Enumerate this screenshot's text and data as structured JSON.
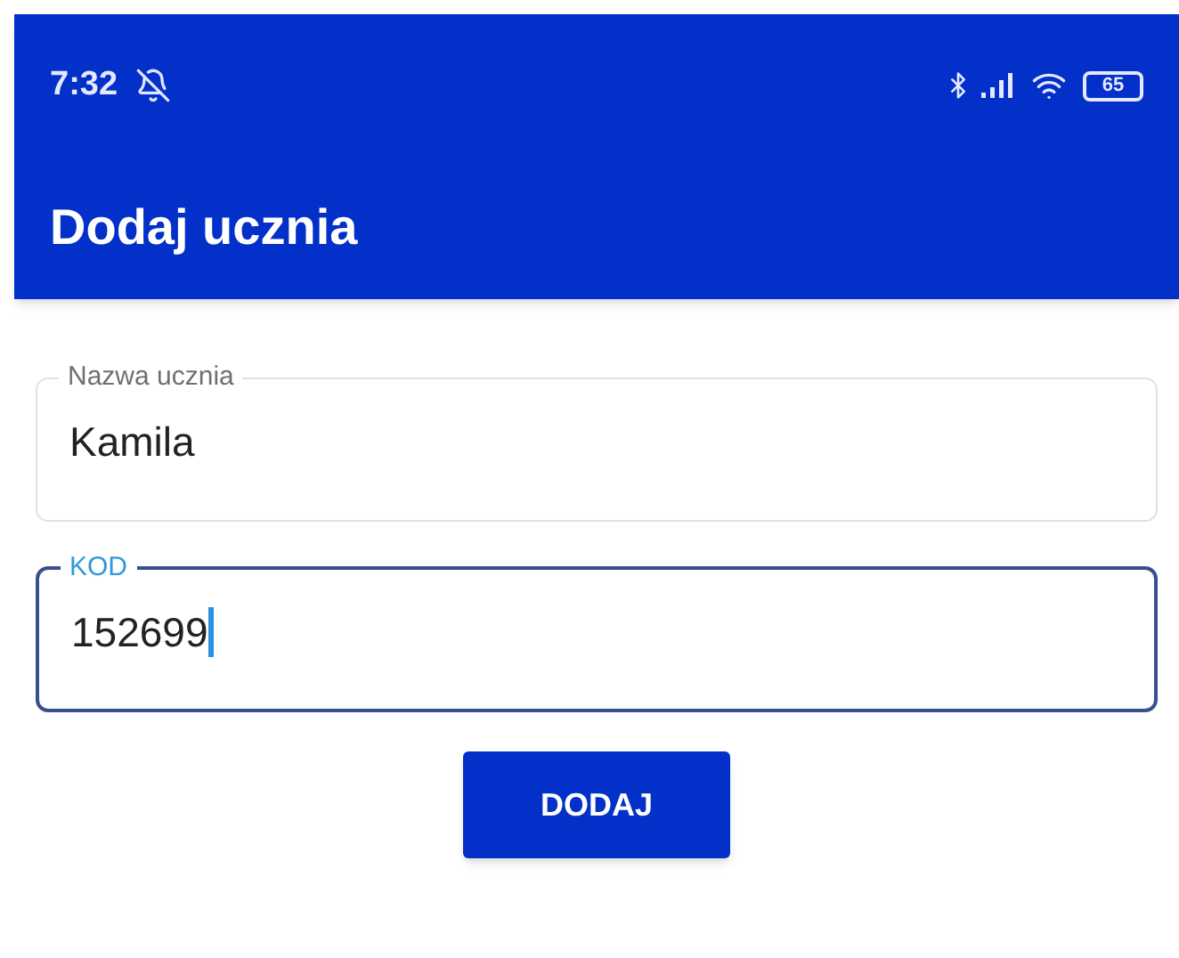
{
  "status_bar": {
    "time": "7:32",
    "battery": "65"
  },
  "app_bar": {
    "title": "Dodaj ucznia"
  },
  "fields": [
    {
      "label": "Nazwa ucznia",
      "value": "Kamila",
      "focused": false
    },
    {
      "label": "KOD",
      "value": "152699",
      "focused": true
    }
  ],
  "button": {
    "label": "DODAJ"
  }
}
